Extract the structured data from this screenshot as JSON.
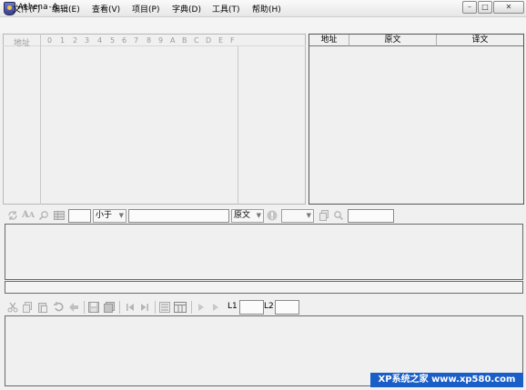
{
  "window": {
    "title": "Athena-A",
    "minimize": "–",
    "maximize": "□",
    "close": "✕"
  },
  "menu": [
    {
      "label": "文件(F)"
    },
    {
      "label": "编辑(E)"
    },
    {
      "label": "查看(V)"
    },
    {
      "label": "项目(P)"
    },
    {
      "label": "字典(D)"
    },
    {
      "label": "工具(T)"
    },
    {
      "label": "帮助(H)"
    }
  ],
  "hex_view": {
    "address_header": "地址",
    "columns": [
      "0",
      "1",
      "2",
      "3",
      "4",
      "5",
      "6",
      "7",
      "8",
      "9",
      "A",
      "B",
      "C",
      "D",
      "E",
      "F"
    ]
  },
  "string_table": {
    "headers": [
      "地址",
      "原文",
      "译文"
    ]
  },
  "search_bar": {
    "compare_value": "小于",
    "source_select": "原文"
  },
  "lower_toolbar": {
    "l1_label": "L1",
    "l2_label": "L2"
  },
  "watermark": {
    "text": "XP系统之家 www.xp580.com"
  }
}
